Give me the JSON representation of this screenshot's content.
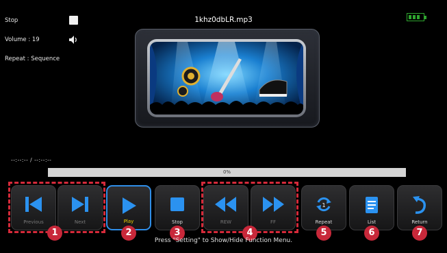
{
  "status": {
    "state_label": "Stop",
    "volume_label": "Volume : 19",
    "repeat_label": "Repeat : Sequence"
  },
  "track": {
    "filename": "1khz0dbLR.mp3"
  },
  "playback": {
    "time_display": "--:--:-- / --:--:--",
    "progress_percent": 0,
    "progress_label": "0%"
  },
  "controls": [
    {
      "id": "previous",
      "label": "Previous",
      "icon": "skip-previous-icon",
      "enabled": false,
      "active": false
    },
    {
      "id": "next",
      "label": "Next",
      "icon": "skip-next-icon",
      "enabled": false,
      "active": false
    },
    {
      "id": "play",
      "label": "Play",
      "icon": "play-icon",
      "enabled": true,
      "active": true
    },
    {
      "id": "stop",
      "label": "Stop",
      "icon": "stop-icon",
      "enabled": true,
      "active": false
    },
    {
      "id": "rew",
      "label": "REW",
      "icon": "rewind-icon",
      "enabled": false,
      "active": false
    },
    {
      "id": "ff",
      "label": "FF",
      "icon": "fast-forward-icon",
      "enabled": false,
      "active": false
    },
    {
      "id": "repeat",
      "label": "Repeat",
      "icon": "repeat-icon",
      "enabled": true,
      "active": false
    },
    {
      "id": "list",
      "label": "List",
      "icon": "list-icon",
      "enabled": true,
      "active": false
    },
    {
      "id": "return",
      "label": "Return",
      "icon": "return-icon",
      "enabled": true,
      "active": false
    }
  ],
  "badges": [
    "1",
    "2",
    "3",
    "4",
    "5",
    "6",
    "7"
  ],
  "hint": "Press \"Setting\" to Show/Hide Function Menu.",
  "colors": {
    "accent_blue": "#2f8ee8",
    "play_label_yellow": "#f2d200",
    "annotation_red": "#d62a3a",
    "battery_green": "#2fa52f"
  }
}
